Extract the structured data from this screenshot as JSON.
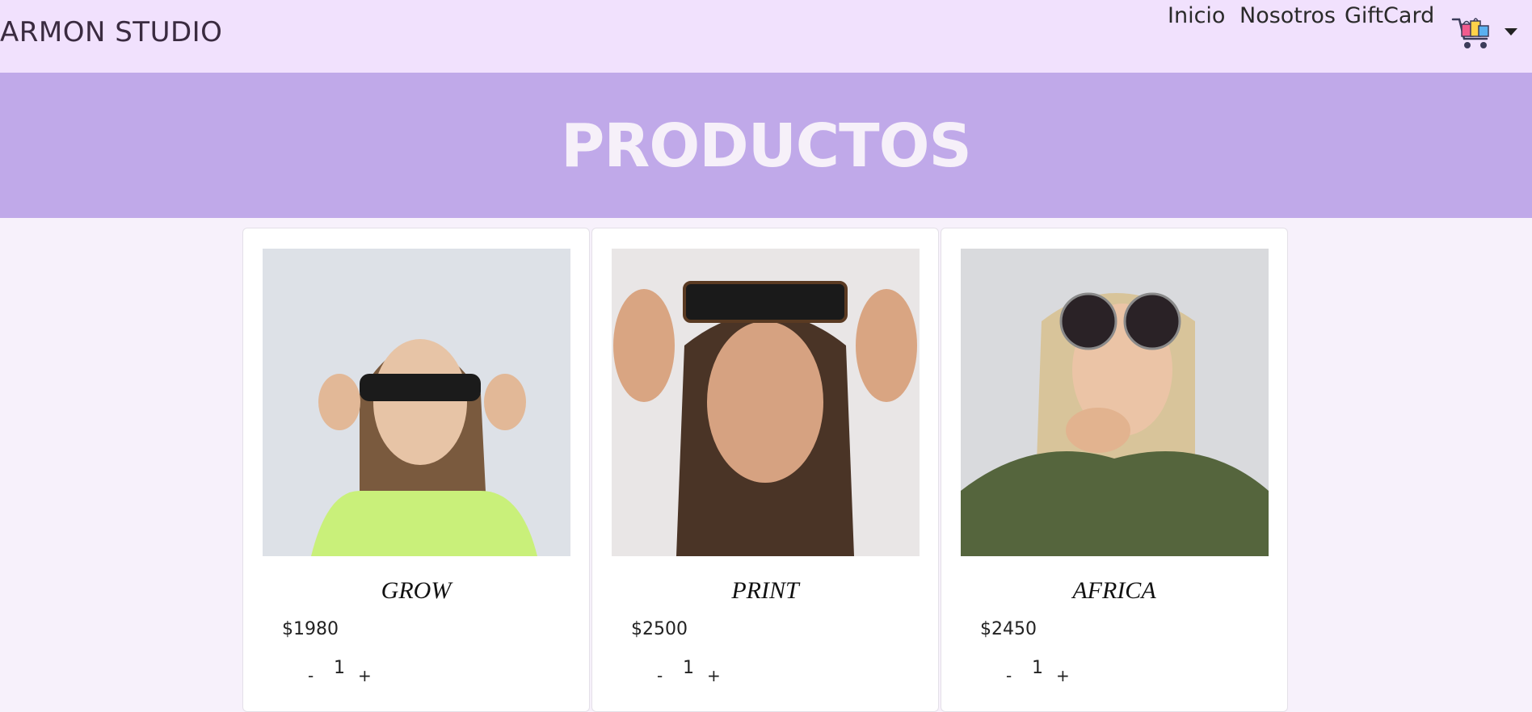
{
  "brand": "ARMON STUDIO",
  "nav": {
    "links": [
      "Inicio",
      "Nosotros",
      "GiftCard"
    ]
  },
  "cart": {
    "icon": "cart-icon"
  },
  "hero": {
    "title": "PRODUCTOS"
  },
  "colors": {
    "navbar_bg": "#f1e1fd",
    "hero_bg": "#c0a9e9",
    "page_bg": "#f7f1fb"
  },
  "products": [
    {
      "name": "GROW",
      "price": "$1980",
      "qty": "1",
      "minus": "-",
      "plus": "+"
    },
    {
      "name": "PRINT",
      "price": "$2500",
      "qty": "1",
      "minus": "-",
      "plus": "+"
    },
    {
      "name": "AFRICA",
      "price": "$2450",
      "qty": "1",
      "minus": "-",
      "plus": "+"
    }
  ]
}
